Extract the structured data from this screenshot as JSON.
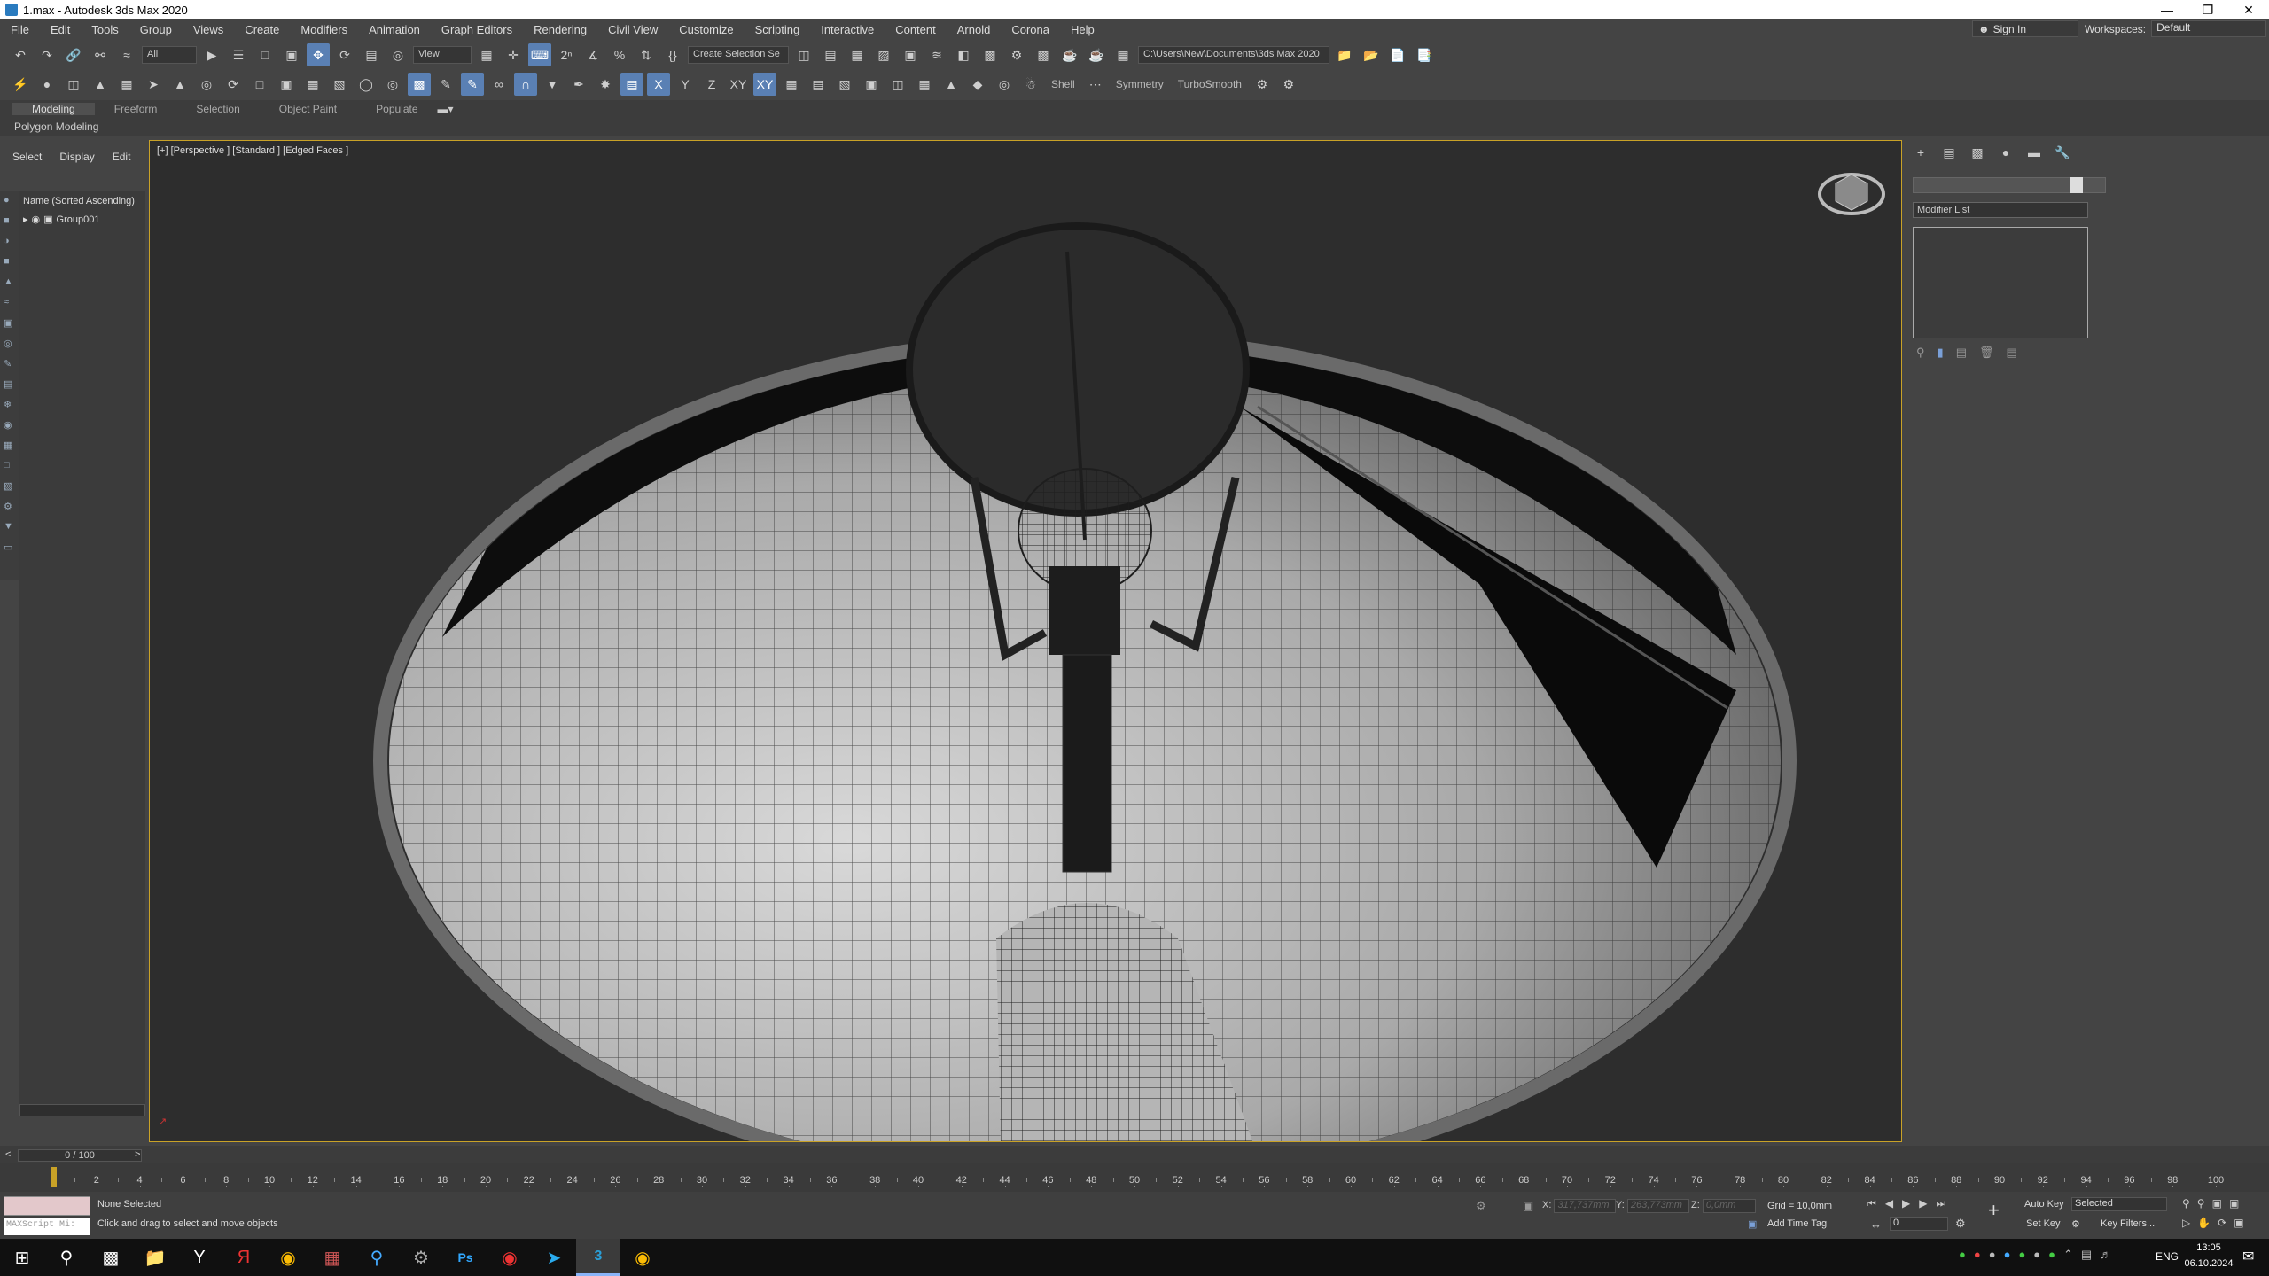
{
  "window": {
    "title": "1.max - Autodesk 3ds Max 2020"
  },
  "menu": [
    "File",
    "Edit",
    "Tools",
    "Group",
    "Views",
    "Create",
    "Modifiers",
    "Animation",
    "Graph Editors",
    "Rendering",
    "Civil View",
    "Customize",
    "Scripting",
    "Interactive",
    "Content",
    "Arnold",
    "Corona",
    "Help"
  ],
  "account": {
    "sign_in": "Sign In",
    "workspaces_label": "Workspaces:",
    "workspace": "Default"
  },
  "toolbar": {
    "filter": "All",
    "ref_coord": "View",
    "selection_set": "Create Selection Se",
    "project_path": "C:\\Users\\New\\Documents\\3ds Max 2020",
    "axis_x": "X",
    "axis_y": "Y",
    "axis_z": "Z",
    "axis_xy": "XY",
    "axis_xy2": "XY",
    "shell": "Shell",
    "symmetry": "Symmetry",
    "turbosmooth": "TurboSmooth"
  },
  "ribbon": {
    "tabs": [
      "Modeling",
      "Freeform",
      "Selection",
      "Object Paint",
      "Populate"
    ],
    "active": "Modeling",
    "sub": "Polygon Modeling"
  },
  "scene_explorer": {
    "tabs": [
      "Select",
      "Display",
      "Edit"
    ],
    "header": "Name (Sorted Ascending)",
    "items": [
      "Group001"
    ]
  },
  "viewport": {
    "label": "[+] [Perspective ] [Standard ] [Edged Faces ]"
  },
  "command_panel": {
    "modifier_list": "Modifier List"
  },
  "timeline": {
    "frame": "0 / 100",
    "ticks": [
      "0",
      "2",
      "4",
      "6",
      "8",
      "10",
      "12",
      "14",
      "16",
      "18",
      "20",
      "22",
      "24",
      "26",
      "28",
      "30",
      "32",
      "34",
      "36",
      "38",
      "40",
      "42",
      "44",
      "46",
      "48",
      "50",
      "52",
      "54",
      "56",
      "58",
      "60",
      "62",
      "64",
      "66",
      "68",
      "70",
      "72",
      "74",
      "76",
      "78",
      "80",
      "82",
      "84",
      "86",
      "88",
      "90",
      "92",
      "94",
      "96",
      "98",
      "100"
    ]
  },
  "status": {
    "maxscript": "MAXScript Mi:",
    "selection": "None Selected",
    "prompt": "Click and drag to select and move objects",
    "x_label": "X:",
    "x_value": "317,737mm",
    "y_label": "Y:",
    "y_value": "263,773mm",
    "z_label": "Z:",
    "z_value": "0,0mm",
    "grid": "Grid = 10,0mm",
    "add_time_tag": "Add Time Tag",
    "auto_key": "Auto Key",
    "set_key": "Set Key",
    "key_mode": "Selected",
    "key_filters": "Key Filters...",
    "frame_field": "0"
  },
  "taskbar": {
    "lang": "ENG",
    "time": "13:05",
    "date": "06.10.2024"
  },
  "colors": {
    "viewport_border": "#c9a227",
    "active_tool": "#5a80b4",
    "bg": "#444444"
  }
}
